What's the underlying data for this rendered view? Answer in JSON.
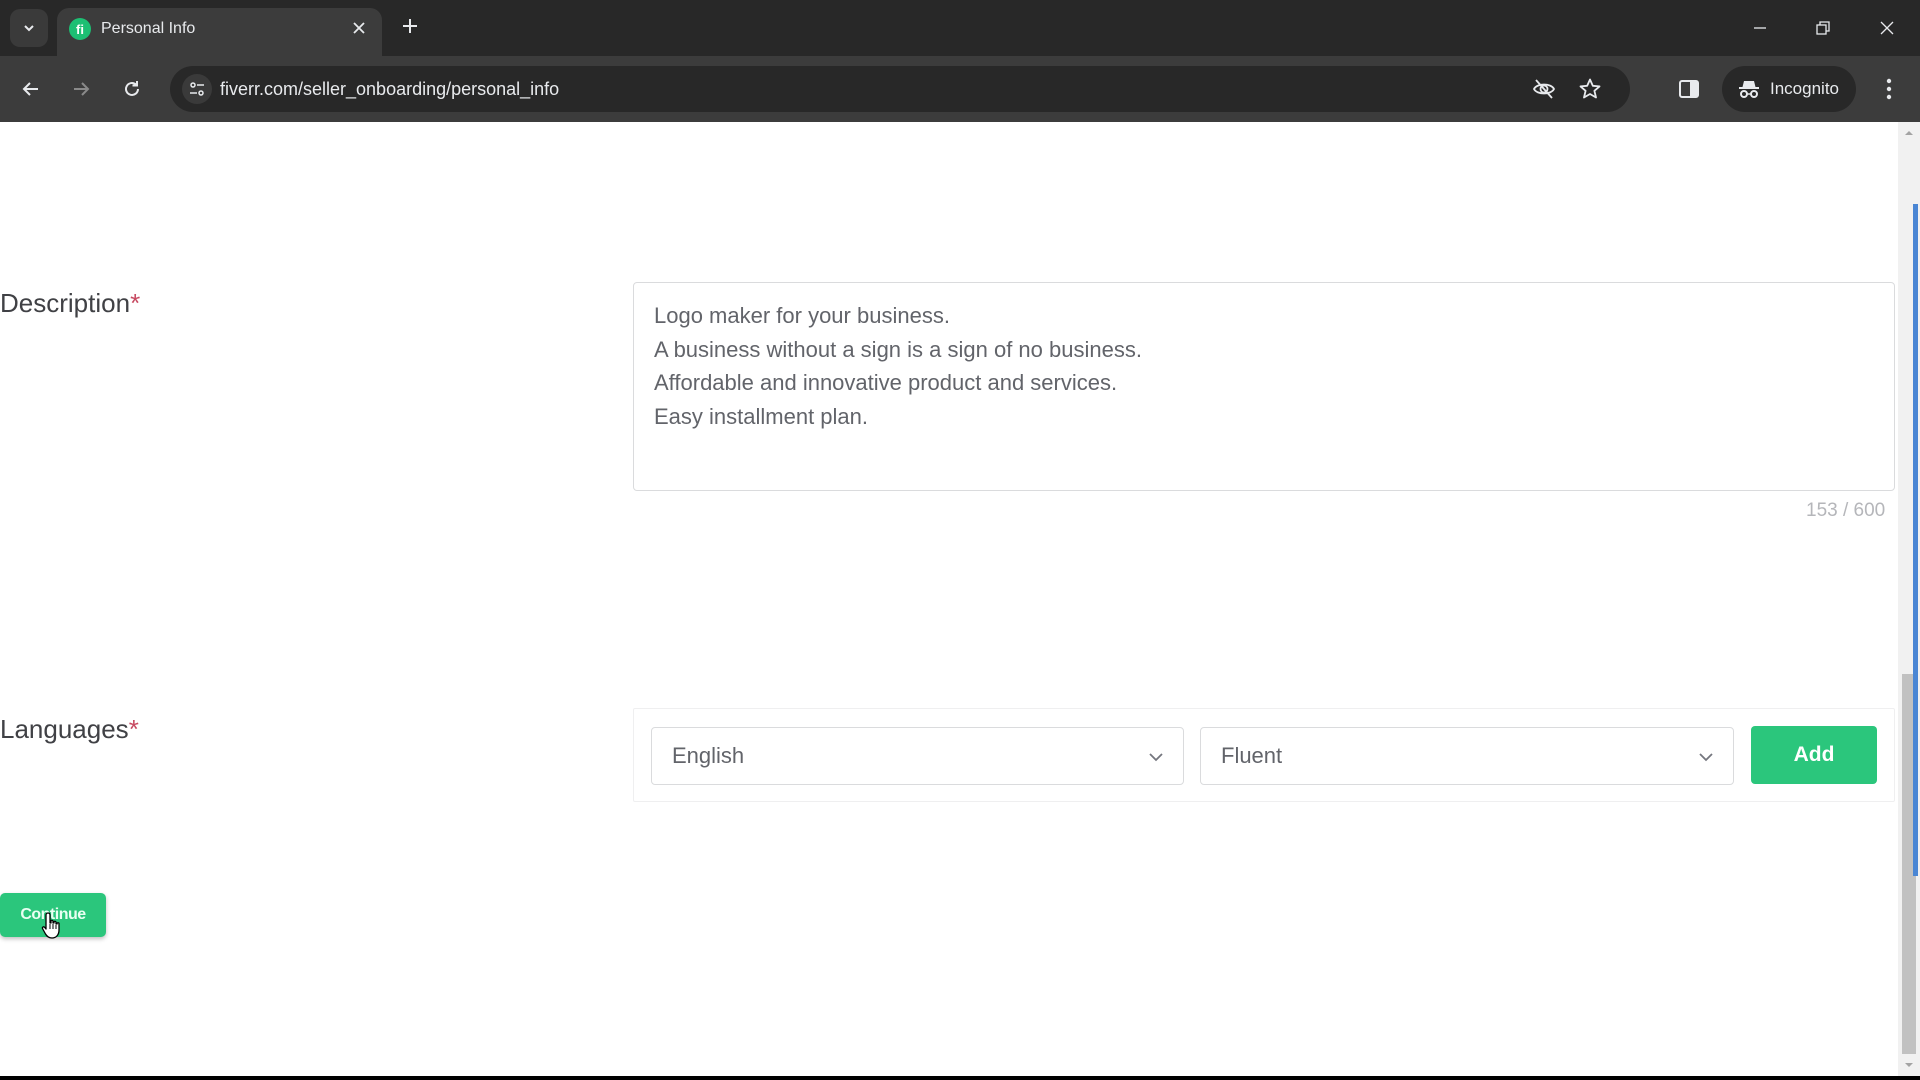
{
  "browser": {
    "tab": {
      "title": "Personal Info",
      "favicon_letter": "fi",
      "favicon_color": "#1dbf73"
    },
    "url": "fiverr.com/seller_onboarding/personal_info",
    "incognito_label": "Incognito",
    "icons": {
      "tab_search": "chevron-down-icon",
      "tab_close": "close-icon",
      "new_tab": "plus-icon",
      "minimize": "minimize-icon",
      "restore": "restore-icon",
      "close_window": "close-icon",
      "back": "arrow-left-icon",
      "forward": "arrow-right-icon",
      "reload": "reload-icon",
      "site_info": "tune-icon",
      "tracking_protection": "eye-off-icon",
      "bookmark": "star-icon",
      "side_panel": "side-panel-icon",
      "incognito": "incognito-icon",
      "menu": "kebab-menu-icon"
    }
  },
  "form": {
    "description": {
      "label": "Description",
      "required_mark": "*",
      "value": "Logo maker for your business.\nA business without a sign is a sign of no business.\nAffordable and innovative product and services.\nEasy installment plan.",
      "counter": "153 / 600",
      "char_count": 153,
      "char_limit": 600
    },
    "languages": {
      "label": "Languages",
      "required_mark": "*",
      "language_select": {
        "value": "English"
      },
      "level_select": {
        "value": "Fluent"
      },
      "add_label": "Add"
    },
    "continue_label": "Continue"
  },
  "colors": {
    "brand_green": "#2bc67c",
    "required_red": "#c74a61",
    "text_gray": "#62646a",
    "label_dark": "#404145"
  }
}
